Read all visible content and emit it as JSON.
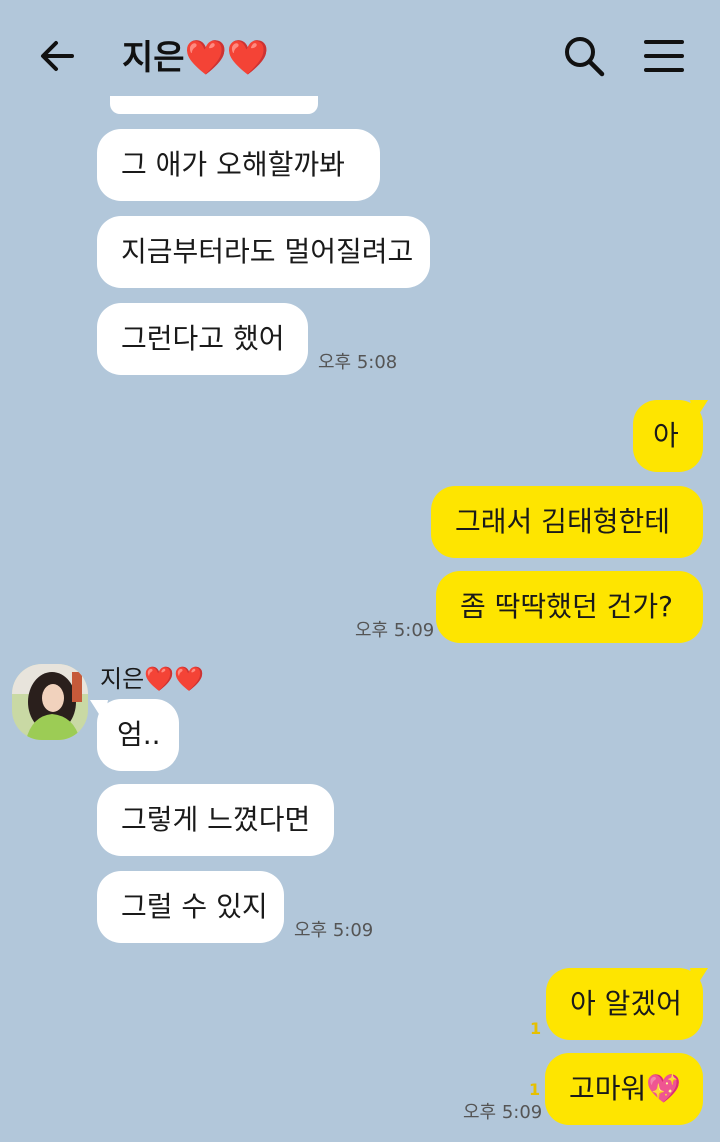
{
  "header": {
    "title": "지은❤️❤️"
  },
  "messages": {
    "m1": "그 애가 오해할까봐",
    "m2": "지금부터라도 멀어질려고",
    "m3": "그런다고 했어",
    "t1": "오후 5:08",
    "m4": "아",
    "m5": "그래서 김태형한테",
    "m6": "좀 딱딱했던 건가?",
    "t2": "오후 5:09",
    "sender": "지은❤️❤️",
    "m7": "엄..",
    "m8": "그렇게 느꼈다면",
    "m9": "그럴 수 있지",
    "t3": "오후 5:09",
    "m10": "아 알겠어",
    "u10": "1",
    "m11": "고마워💖",
    "u11": "1",
    "t4": "오후 5:09"
  },
  "colors": {
    "background": "#b2c7da",
    "outgoing_bubble": "#fee500",
    "incoming_bubble": "#ffffff",
    "unread_count": "#e6c000"
  },
  "icons": {
    "back": "arrow-left-icon",
    "search": "search-icon",
    "menu": "hamburger-menu-icon"
  }
}
